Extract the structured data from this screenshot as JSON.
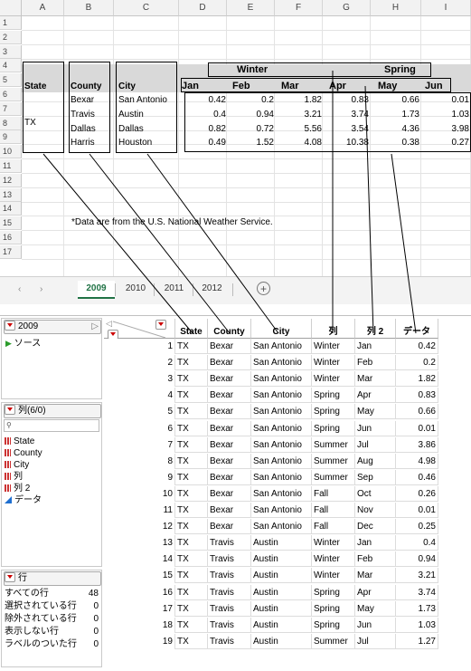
{
  "excel": {
    "columns": [
      "A",
      "B",
      "C",
      "D",
      "E",
      "F",
      "G",
      "H",
      "I"
    ],
    "rows": [
      "1",
      "2",
      "3",
      "4",
      "5",
      "6",
      "7",
      "8",
      "9",
      "10",
      "11",
      "12",
      "13",
      "14",
      "15",
      "16",
      "17"
    ],
    "headers": {
      "state": "State",
      "county": "County",
      "city": "City"
    },
    "season_headers": {
      "winter": "Winter",
      "spring": "Spring"
    },
    "months": [
      "Jan",
      "Feb",
      "Mar",
      "Apr",
      "May",
      "Jun"
    ],
    "state_value": "TX",
    "data_rows": [
      {
        "county": "Bexar",
        "city": "San Antonio",
        "values": [
          "0.42",
          "0.2",
          "1.82",
          "0.83",
          "0.66",
          "0.01"
        ]
      },
      {
        "county": "Travis",
        "city": "Austin",
        "values": [
          "0.4",
          "0.94",
          "3.21",
          "3.74",
          "1.73",
          "1.03"
        ]
      },
      {
        "county": "Dallas",
        "city": "Dallas",
        "values": [
          "0.82",
          "0.72",
          "5.56",
          "3.54",
          "4.36",
          "3.98"
        ]
      },
      {
        "county": "Harris",
        "city": "Houston",
        "values": [
          "0.49",
          "1.52",
          "4.08",
          "10.38",
          "0.38",
          "0.27"
        ]
      }
    ],
    "note": "*Data are from the U.S. National Weather Service.",
    "tabs": [
      "2009",
      "2010",
      "2011",
      "2012"
    ],
    "active_tab": "2009",
    "add_sheet": "+"
  },
  "jmp": {
    "table_name": "2009",
    "source": "ソース",
    "columns_header": "列(6/0)",
    "search_glyph": "🔍",
    "column_list": [
      {
        "name": "State",
        "type": "nominal"
      },
      {
        "name": "County",
        "type": "nominal"
      },
      {
        "name": "City",
        "type": "nominal"
      },
      {
        "name": "列",
        "type": "nominal"
      },
      {
        "name": "列 2",
        "type": "nominal"
      },
      {
        "name": "データ",
        "type": "continuous"
      }
    ],
    "rows_header": "行",
    "row_stats": [
      {
        "label": "すべての行",
        "value": "48"
      },
      {
        "label": "選択されている行",
        "value": "0"
      },
      {
        "label": "除外されている行",
        "value": "0"
      },
      {
        "label": "表示しない行",
        "value": "0"
      },
      {
        "label": "ラベルのついた行",
        "value": "0"
      }
    ],
    "table_headers": [
      "State",
      "County",
      "City",
      "列",
      "列 2",
      "データ"
    ],
    "table_rows": [
      [
        "1",
        "TX",
        "Bexar",
        "San Antonio",
        "Winter",
        "Jan",
        "0.42"
      ],
      [
        "2",
        "TX",
        "Bexar",
        "San Antonio",
        "Winter",
        "Feb",
        "0.2"
      ],
      [
        "3",
        "TX",
        "Bexar",
        "San Antonio",
        "Winter",
        "Mar",
        "1.82"
      ],
      [
        "4",
        "TX",
        "Bexar",
        "San Antonio",
        "Spring",
        "Apr",
        "0.83"
      ],
      [
        "5",
        "TX",
        "Bexar",
        "San Antonio",
        "Spring",
        "May",
        "0.66"
      ],
      [
        "6",
        "TX",
        "Bexar",
        "San Antonio",
        "Spring",
        "Jun",
        "0.01"
      ],
      [
        "7",
        "TX",
        "Bexar",
        "San Antonio",
        "Summer",
        "Jul",
        "3.86"
      ],
      [
        "8",
        "TX",
        "Bexar",
        "San Antonio",
        "Summer",
        "Aug",
        "4.98"
      ],
      [
        "9",
        "TX",
        "Bexar",
        "San Antonio",
        "Summer",
        "Sep",
        "0.46"
      ],
      [
        "10",
        "TX",
        "Bexar",
        "San Antonio",
        "Fall",
        "Oct",
        "0.26"
      ],
      [
        "11",
        "TX",
        "Bexar",
        "San Antonio",
        "Fall",
        "Nov",
        "0.01"
      ],
      [
        "12",
        "TX",
        "Bexar",
        "San Antonio",
        "Fall",
        "Dec",
        "0.25"
      ],
      [
        "13",
        "TX",
        "Travis",
        "Austin",
        "Winter",
        "Jan",
        "0.4"
      ],
      [
        "14",
        "TX",
        "Travis",
        "Austin",
        "Winter",
        "Feb",
        "0.94"
      ],
      [
        "15",
        "TX",
        "Travis",
        "Austin",
        "Winter",
        "Mar",
        "3.21"
      ],
      [
        "16",
        "TX",
        "Travis",
        "Austin",
        "Spring",
        "Apr",
        "3.74"
      ],
      [
        "17",
        "TX",
        "Travis",
        "Austin",
        "Spring",
        "May",
        "1.73"
      ],
      [
        "18",
        "TX",
        "Travis",
        "Austin",
        "Spring",
        "Jun",
        "1.03"
      ],
      [
        "19",
        "TX",
        "Travis",
        "Austin",
        "Summer",
        "Jul",
        "1.27"
      ]
    ]
  }
}
